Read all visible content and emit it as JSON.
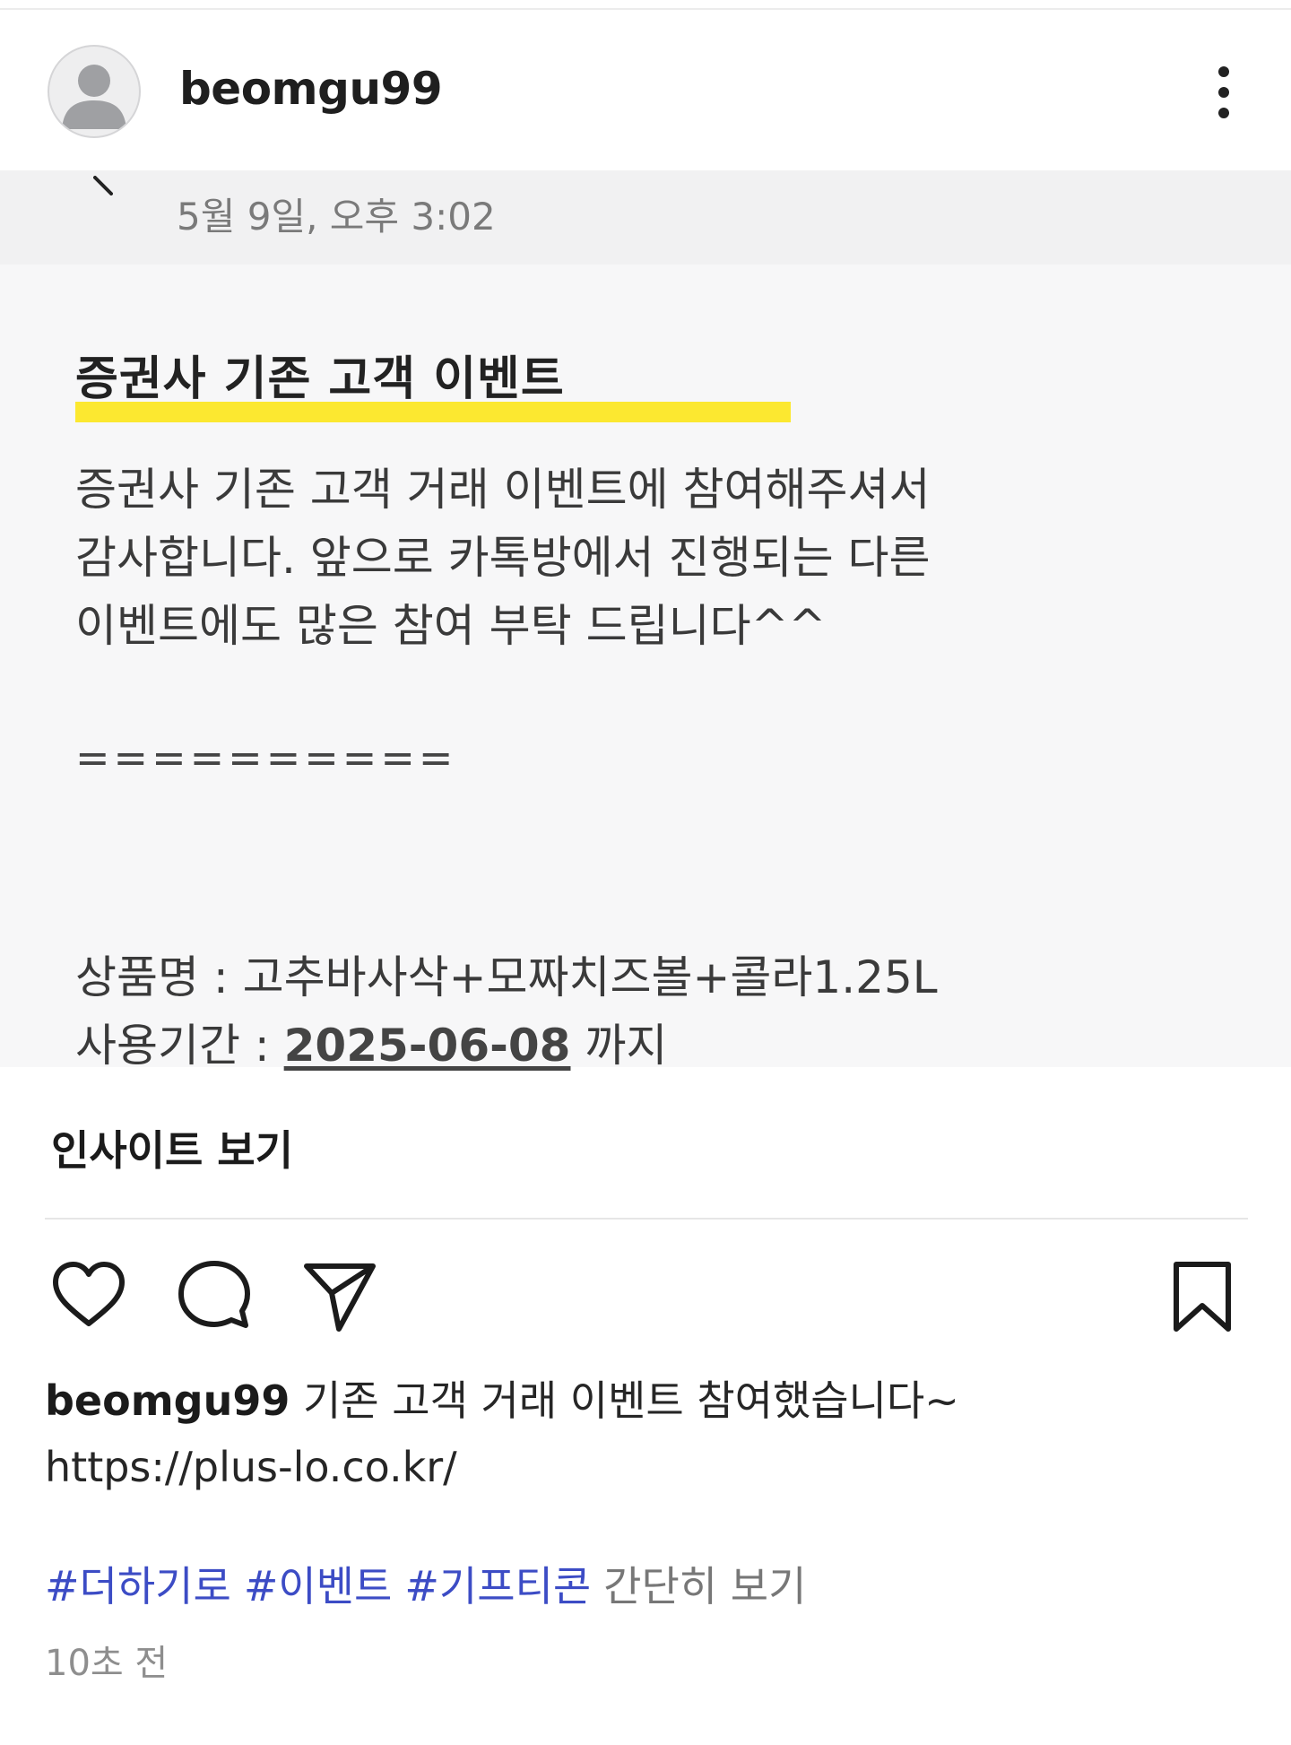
{
  "header": {
    "username": "beomgu99",
    "avatar_icon": "default-avatar-icon",
    "more_icon": "more-vertical-icon"
  },
  "post_image": {
    "date": "5월 9일, 오후 3:02",
    "title": "증권사 기존 고객 이벤트",
    "highlight_color": "#fce830",
    "body_lines": [
      "증권사 기존 고객 거래 이벤트에 참여해주셔서",
      "감사합니다. 앞으로 카톡방에서 진행되는 다른",
      "이벤트에도 많은 참여 부탁 드립니다^^"
    ],
    "divider": "==========",
    "product_label": "상품명 : 고추바사삭+모짜치즈볼+콜라1.25L",
    "period_label": "사용기간 : ",
    "period_date": "2025-06-08",
    "period_suffix": " 까지"
  },
  "insights_label": "인사이트 보기",
  "actions": {
    "like_icon": "heart-icon",
    "comment_icon": "comment-icon",
    "share_icon": "send-icon",
    "save_icon": "bookmark-icon"
  },
  "caption": {
    "username": "beomgu99",
    "text": " 기존 고객 거래 이벤트 참여했습니다~",
    "link": "https://plus-lo.co.kr/"
  },
  "hashtags": [
    "#더하기로",
    "#이벤트",
    "#기프티콘"
  ],
  "collapse_label": "간단히 보기",
  "timestamp": "10초 전",
  "colors": {
    "hashtag": "#3c4cc5",
    "post_background": "#f7f7f8"
  }
}
